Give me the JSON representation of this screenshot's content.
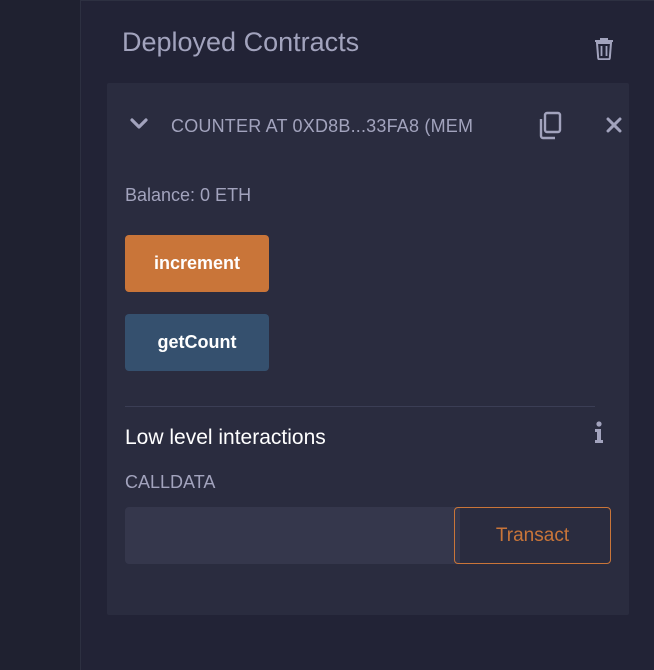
{
  "panel": {
    "title": "Deployed Contracts",
    "trash_icon": "trash-icon"
  },
  "contract": {
    "label": "COUNTER AT 0XD8B...33FA8 (MEM",
    "expand_icon": "chevron-down-icon",
    "copy_icon": "copy-icon",
    "close_icon": "close-icon",
    "balance": "Balance: 0 ETH",
    "functions": [
      {
        "label": "increment",
        "kind": "transact",
        "color": "#c97539"
      },
      {
        "label": "getCount",
        "kind": "call",
        "color": "#35506e"
      }
    ]
  },
  "low_level": {
    "title": "Low level interactions",
    "info_icon": "info-icon",
    "calldata_label": "CALLDATA",
    "calldata_value": "",
    "transact_label": "Transact"
  },
  "colors": {
    "background": "#222336",
    "card": "#2a2c3f",
    "accent_orange": "#c97539",
    "call_blue": "#35506e",
    "muted_text": "#a2a3bd"
  }
}
